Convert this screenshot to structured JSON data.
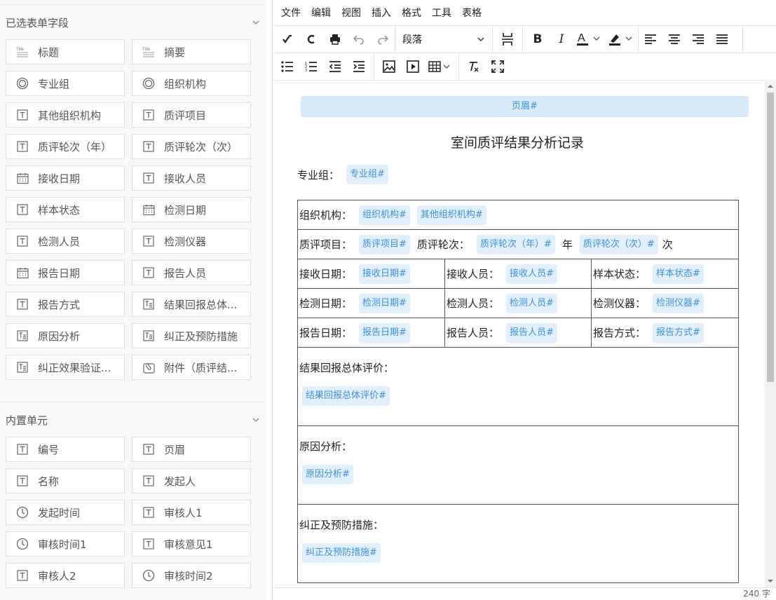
{
  "left_panel": {
    "section1_title": "已选表单字段",
    "section1_items": [
      {
        "icon": "title-icon",
        "label": "标题"
      },
      {
        "icon": "title-icon",
        "label": "摘要"
      },
      {
        "icon": "radio-icon",
        "label": "专业组"
      },
      {
        "icon": "radio-icon",
        "label": "组织机构"
      },
      {
        "icon": "text-icon",
        "label": "其他组织机构"
      },
      {
        "icon": "text-icon",
        "label": "质评项目"
      },
      {
        "icon": "text-icon",
        "label": "质评轮次（年）"
      },
      {
        "icon": "text-icon",
        "label": "质评轮次（次）"
      },
      {
        "icon": "calendar-icon",
        "label": "接收日期"
      },
      {
        "icon": "text-icon",
        "label": "接收人员"
      },
      {
        "icon": "text-icon",
        "label": "样本状态"
      },
      {
        "icon": "calendar-icon",
        "label": "检测日期"
      },
      {
        "icon": "text-icon",
        "label": "检测人员"
      },
      {
        "icon": "text-icon",
        "label": "检测仪器"
      },
      {
        "icon": "calendar-icon",
        "label": "报告日期"
      },
      {
        "icon": "text-icon",
        "label": "报告人员"
      },
      {
        "icon": "text-icon",
        "label": "报告方式"
      },
      {
        "icon": "textarea-icon",
        "label": "结果回报总体..."
      },
      {
        "icon": "textarea-icon",
        "label": "原因分析"
      },
      {
        "icon": "textarea-icon",
        "label": "纠正及预防措施"
      },
      {
        "icon": "textarea-icon",
        "label": "纠正效果验证..."
      },
      {
        "icon": "attachment-icon",
        "label": "附件（质评结..."
      }
    ],
    "section2_title": "内置单元",
    "section2_items": [
      {
        "icon": "text-icon",
        "label": "编号"
      },
      {
        "icon": "text-icon",
        "label": "页眉"
      },
      {
        "icon": "text-icon",
        "label": "名称"
      },
      {
        "icon": "text-icon",
        "label": "发起人"
      },
      {
        "icon": "clock-icon",
        "label": "发起时间"
      },
      {
        "icon": "text-icon",
        "label": "审核人1"
      },
      {
        "icon": "clock-icon",
        "label": "审核时间1"
      },
      {
        "icon": "text-icon",
        "label": "审核意见1"
      },
      {
        "icon": "text-icon",
        "label": "审核人2"
      },
      {
        "icon": "clock-icon",
        "label": "审核时间2"
      }
    ]
  },
  "menubar": [
    "文件",
    "编辑",
    "视图",
    "插入",
    "格式",
    "工具",
    "表格"
  ],
  "toolbar": {
    "paragraph_select": "段落"
  },
  "document": {
    "header_tag": "页眉#",
    "title": "室间质评结果分析记录",
    "group_label": "专业组：",
    "group_tag": "专业组#",
    "row_org": {
      "label": "组织机构：",
      "tag1": "组织机构#",
      "tag2": "其他组织机构#"
    },
    "row_item": {
      "label": "质评项目：",
      "tag": "质评项目#",
      "round_label": "质评轮次：",
      "year_tag": "质评轮次（年）#",
      "year_text": "年",
      "times_tag": "质评轮次（次）#",
      "times_text": "次"
    },
    "row_receive": [
      {
        "label": "接收日期：",
        "tag": "接收日期#"
      },
      {
        "label": "接收人员：",
        "tag": "接收人员#"
      },
      {
        "label": "样本状态：",
        "tag": "样本状态#"
      }
    ],
    "row_detect": [
      {
        "label": "检测日期：",
        "tag": "检测日期#"
      },
      {
        "label": "检测人员：",
        "tag": "检测人员#"
      },
      {
        "label": "检测仪器：",
        "tag": "检测仪器#"
      }
    ],
    "row_report": [
      {
        "label": "报告日期：",
        "tag": "报告日期#"
      },
      {
        "label": "报告人员：",
        "tag": "报告人员#"
      },
      {
        "label": "报告方式：",
        "tag": "报告方式#"
      }
    ],
    "result_eval": {
      "label": "结果回报总体评价：",
      "tag": "结果回报总体评价#"
    },
    "cause": {
      "label": "原因分析：",
      "tag": "原因分析#"
    },
    "prevent": {
      "label": "纠正及预防措施：",
      "tag": "纠正及预防措施#"
    }
  },
  "statusbar": {
    "word_count": "240 字"
  },
  "colors": {
    "tag_bg": "#e1f0fc",
    "tag_text": "#3d8fe0",
    "panel_bg": "#f7f8fa"
  }
}
